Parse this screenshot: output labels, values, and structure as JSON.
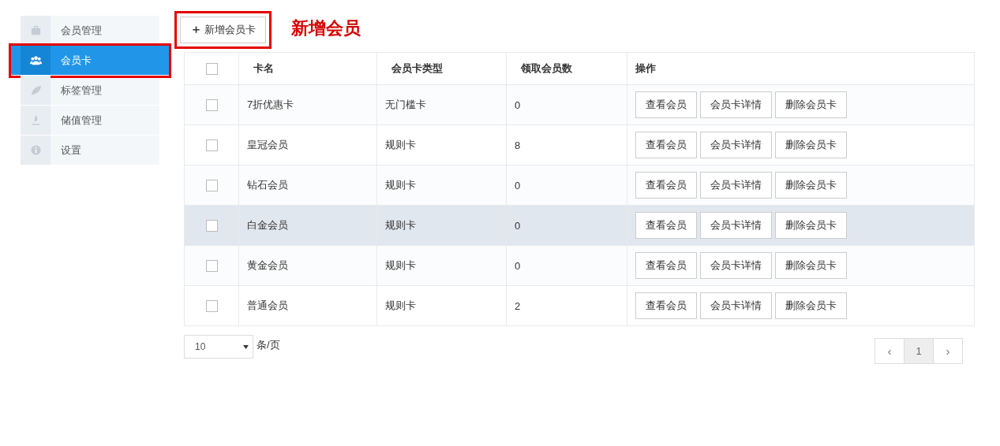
{
  "sidebar": {
    "items": [
      {
        "label": "会员管理",
        "kind": "briefcase",
        "selected": false,
        "annotated": false
      },
      {
        "label": "会员卡",
        "kind": "users",
        "selected": true,
        "annotated": true
      },
      {
        "label": "标签管理",
        "kind": "leaf",
        "selected": false,
        "annotated": false
      },
      {
        "label": "储值管理",
        "kind": "flame",
        "selected": false,
        "annotated": false
      },
      {
        "label": "设置",
        "kind": "info",
        "selected": false,
        "annotated": false
      }
    ]
  },
  "toolbar": {
    "add_button": {
      "icon": "＋",
      "label": "新增会员卡",
      "annotated": true
    },
    "annotation": "新增会员"
  },
  "table": {
    "select_all": {
      "checked": false
    },
    "columns": [
      "卡名",
      "会员卡类型",
      "领取会员数",
      "操作"
    ],
    "rows": [
      {
        "checked": false,
        "highlighted": false,
        "name": "7折优惠卡",
        "type": "无门槛卡",
        "count": "0",
        "actions": [
          "查看会员",
          "会员卡详情",
          "删除会员卡"
        ]
      },
      {
        "checked": false,
        "highlighted": false,
        "name": "皇冠会员",
        "type": "规则卡",
        "count": "8",
        "actions": [
          "查看会员",
          "会员卡详情",
          "删除会员卡"
        ]
      },
      {
        "checked": false,
        "highlighted": false,
        "name": "钻石会员",
        "type": "规则卡",
        "count": "0",
        "actions": [
          "查看会员",
          "会员卡详情",
          "删除会员卡"
        ]
      },
      {
        "checked": false,
        "highlighted": true,
        "name": "白金会员",
        "type": "规则卡",
        "count": "0",
        "actions": [
          "查看会员",
          "会员卡详情",
          "删除会员卡"
        ]
      },
      {
        "checked": false,
        "highlighted": false,
        "name": "黄金会员",
        "type": "规则卡",
        "count": "0",
        "actions": [
          "查看会员",
          "会员卡详情",
          "删除会员卡"
        ]
      },
      {
        "checked": false,
        "highlighted": false,
        "name": "普通会员",
        "type": "规则卡",
        "count": "2",
        "actions": [
          "查看会员",
          "会员卡详情",
          "删除会员卡"
        ]
      }
    ]
  },
  "page_size": {
    "value": "10",
    "label": "条/页"
  },
  "pagination": {
    "prev": "‹",
    "pages": [
      {
        "label": "1",
        "selected": true
      }
    ],
    "next": "›"
  }
}
